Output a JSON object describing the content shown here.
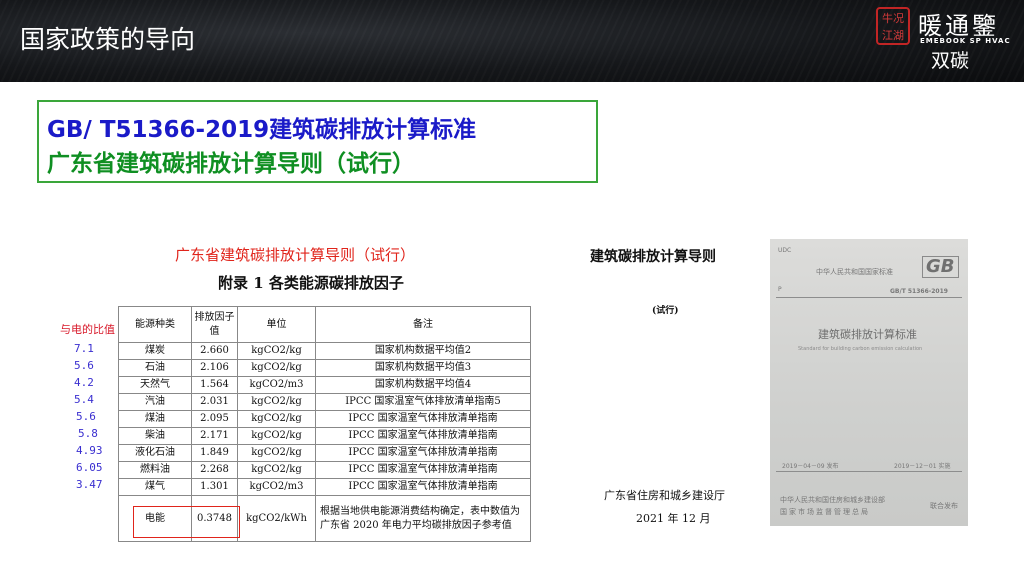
{
  "header": {
    "title": "国家政策的导向",
    "seal_text": "牛况江湖",
    "brand_name": "暖通鑒",
    "brand_en": "EMEBOOK SP HVAC",
    "tag": "双碳"
  },
  "standards": {
    "gb_title": "GB/ T51366-2019建筑碳排放计算标准",
    "guangdong_title": "广东省建筑碳排放计算导则（试行）"
  },
  "appendix": {
    "doc_title": "广东省建筑碳排放计算导则（试行）",
    "appendix_title": "附录 1  各类能源碳排放因子",
    "ratio_header": "与电的比值",
    "ratios": [
      "7.1",
      "5.6",
      "4.2",
      "5.4",
      "5.6",
      "5.8",
      "4.93",
      "6.05",
      "3.47"
    ],
    "columns": [
      "能源种类",
      "排放因子值",
      "单位",
      "备注"
    ],
    "rows": [
      {
        "type": "煤炭",
        "factor": "2.660",
        "unit": "kgCO2/kg",
        "note": "国家机构数据平均值2"
      },
      {
        "type": "石油",
        "factor": "2.106",
        "unit": "kgCO2/kg",
        "note": "国家机构数据平均值3"
      },
      {
        "type": "天然气",
        "factor": "1.564",
        "unit": "kgCO2/m3",
        "note": "国家机构数据平均值4"
      },
      {
        "type": "汽油",
        "factor": "2.031",
        "unit": "kgCO2/kg",
        "note": "IPCC 国家温室气体排放清单指南5"
      },
      {
        "type": "煤油",
        "factor": "2.095",
        "unit": "kgCO2/kg",
        "note": "IPCC 国家温室气体排放清单指南"
      },
      {
        "type": "柴油",
        "factor": "2.171",
        "unit": "kgCO2/kg",
        "note": "IPCC 国家温室气体排放清单指南"
      },
      {
        "type": "液化石油",
        "factor": "1.849",
        "unit": "kgCO2/kg",
        "note": "IPCC 国家温室气体排放清单指南"
      },
      {
        "type": "燃料油",
        "factor": "2.268",
        "unit": "kgCO2/kg",
        "note": "IPCC 国家温室气体排放清单指南"
      },
      {
        "type": "煤气",
        "factor": "1.301",
        "unit": "kgCO2/m3",
        "note": "IPCC 国家温室气体排放清单指南"
      }
    ],
    "electricity": {
      "type": "电能",
      "factor": "0.3748",
      "unit": "kgCO2/kWh",
      "note": "根据当地供电能源消费结构确定，表中数值为广东省 2020 年电力平均碳排放因子参考值"
    }
  },
  "cover_left": {
    "title": "建筑碳排放计算导则",
    "trial": "(试行)",
    "issuer": "广东省住房和城乡建设厅",
    "date": "2021 年 12 月"
  },
  "cover_gb": {
    "udc": "UDC",
    "std_org": "中华人民共和国国家标准",
    "logo": "GB",
    "p_mark": "P",
    "gb_number": "GB/T 51366-2019",
    "title_cn": "建筑碳排放计算标准",
    "title_en": "Standard for building carbon emission calculation",
    "pub_date": "2019－04－09  发布",
    "impl_date": "2019－12－01  实施",
    "issuer_line1": "中华人民共和国住房和城乡建设部",
    "issuer_line2": "国家市场监督管理总局",
    "co_issue": "联合发布"
  }
}
